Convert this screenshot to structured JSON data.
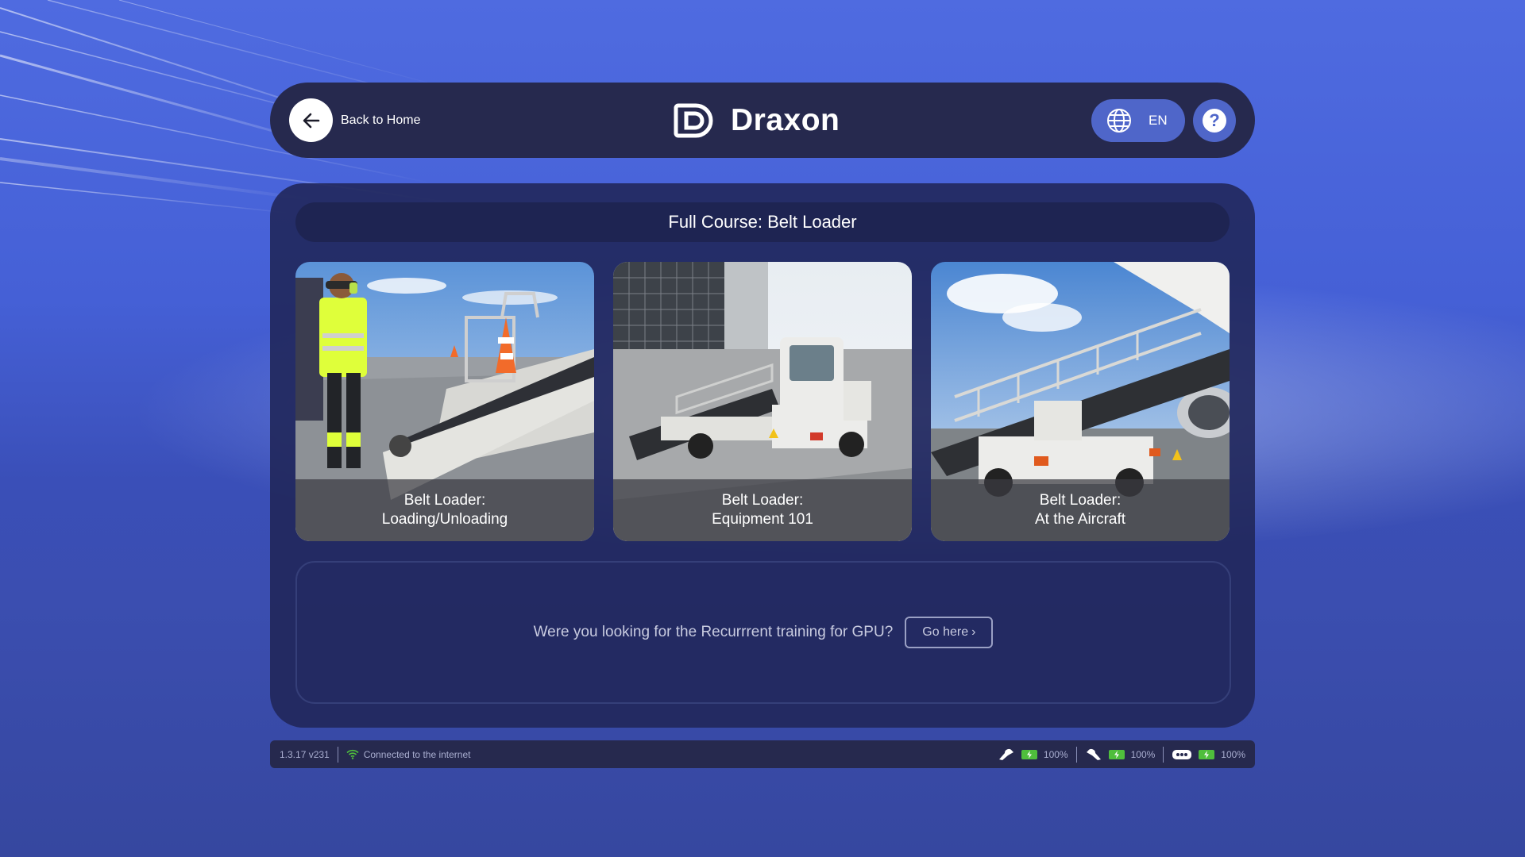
{
  "header": {
    "back_label": "Back to Home",
    "brand": "Draxon",
    "language": "EN",
    "help_symbol": "?"
  },
  "main": {
    "course_title": "Full Course: Belt Loader",
    "cards": [
      {
        "line1": "Belt Loader:",
        "line2": "Loading/Unloading"
      },
      {
        "line1": "Belt Loader:",
        "line2": "Equipment 101"
      },
      {
        "line1": "Belt Loader:",
        "line2": "At the Aircraft"
      }
    ],
    "suggestion": {
      "text": "Were you looking for the Recurrrent training for GPU?",
      "button_label": "Go here",
      "button_chevron": "›"
    }
  },
  "status": {
    "version": "1.3.17 v231",
    "connection": "Connected to the internet",
    "devices": [
      {
        "icon": "left-controller-icon",
        "battery": "100%"
      },
      {
        "icon": "right-controller-icon",
        "battery": "100%"
      },
      {
        "icon": "headset-icon",
        "battery": "100%"
      }
    ]
  },
  "icons": {
    "back": "arrow-left-icon",
    "language": "globe-icon",
    "help": "help-icon",
    "wifi": "wifi-icon"
  },
  "colors": {
    "background": "#4560d6",
    "header_bg": "#26294e",
    "panel_bg": "#202658",
    "accent_button": "#4f66c9",
    "battery": "#4fbe3c"
  }
}
